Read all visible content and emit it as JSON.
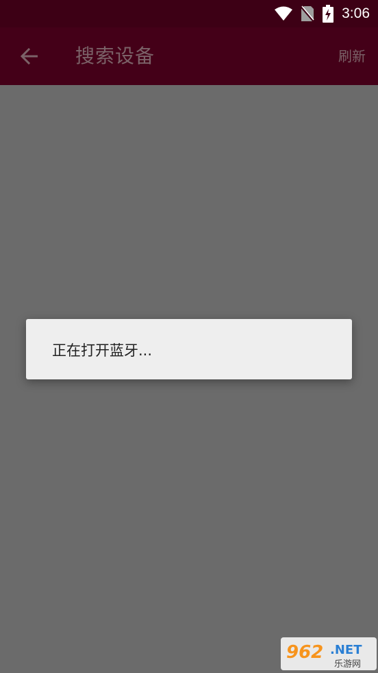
{
  "status_bar": {
    "time": "3:06",
    "icons": [
      "wifi-icon",
      "no-sim-icon",
      "battery-charging-icon"
    ]
  },
  "app_bar": {
    "back_icon": "arrow-left-icon",
    "title": "搜索设备",
    "refresh_label": "刷新"
  },
  "dialog": {
    "message": "正在打开蓝牙..."
  },
  "watermark": {
    "brand": "962.NET",
    "site": "乐游网"
  },
  "colors": {
    "status_bar_bg": "#3d0015",
    "app_bar_bg": "#440018",
    "scrim": "#6b6b6b",
    "dialog_bg": "#eeeeee"
  }
}
